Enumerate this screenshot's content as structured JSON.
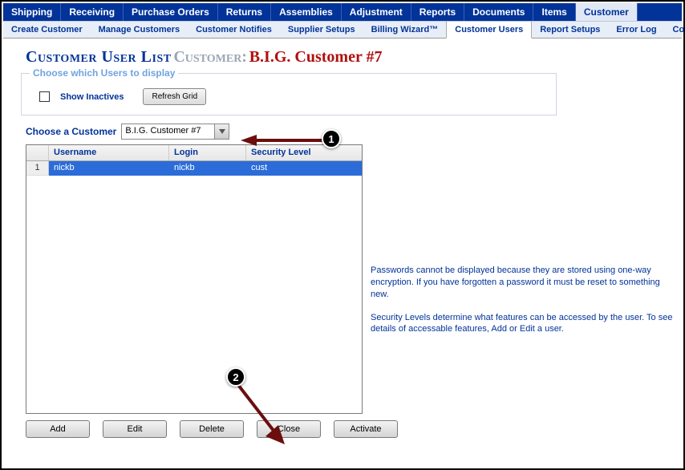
{
  "topnav": [
    "Shipping",
    "Receiving",
    "Purchase Orders",
    "Returns",
    "Assemblies",
    "Adjustment",
    "Reports",
    "Documents",
    "Items",
    "Customer"
  ],
  "topnav_active": 9,
  "subnav": [
    "Create Customer",
    "Manage Customers",
    "Customer Notifies",
    "Supplier Setups",
    "Billing Wizard™",
    "Customer Users",
    "Report Setups",
    "Error Log",
    "Connect"
  ],
  "subnav_active": 5,
  "title": {
    "main": "Customer User List",
    "sub_label": "Customer:",
    "customer_name": "B.I.G. Customer #7"
  },
  "filter": {
    "legend": "Choose which Users to display",
    "show_inactives_label": "Show Inactives",
    "show_inactives_checked": false,
    "refresh_label": "Refresh Grid"
  },
  "choose": {
    "label": "Choose a Customer",
    "value": "B.I.G. Customer #7"
  },
  "grid": {
    "columns": [
      "Username",
      "Login",
      "Security Level"
    ],
    "rows": [
      {
        "n": "1",
        "username": "nickb",
        "login": "nickb",
        "security": "cust",
        "selected": true
      }
    ]
  },
  "info": {
    "p1": "Passwords cannot be displayed because they are stored using one-way encryption. If you have forgotten a password it must be reset to something new.",
    "p2": "Security Levels determine what features can be accessed by the user. To see details of accessable features, Add or Edit a user."
  },
  "actions": [
    "Add",
    "Edit",
    "Delete",
    "Close",
    "Activate"
  ],
  "callouts": {
    "1": "1",
    "2": "2"
  }
}
